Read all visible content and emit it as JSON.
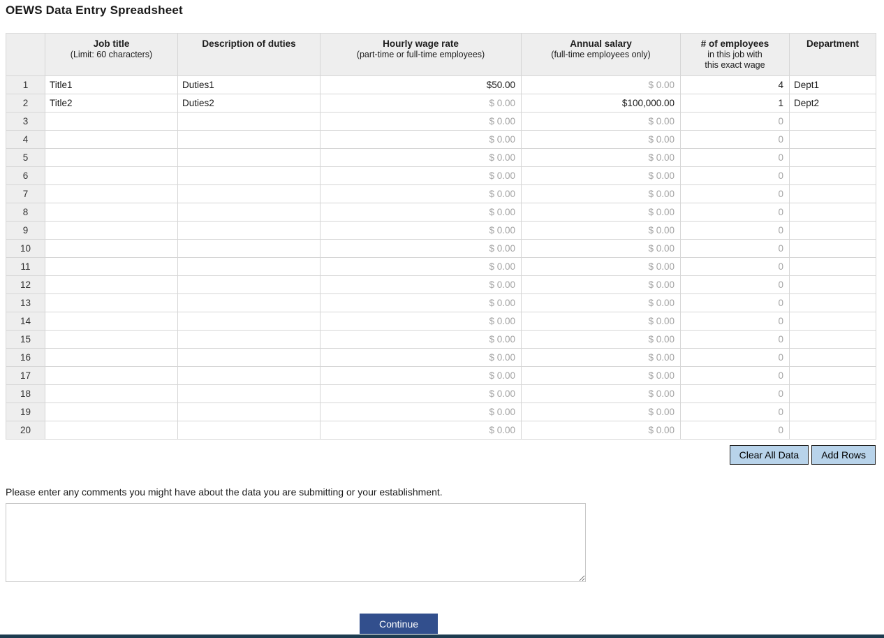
{
  "page": {
    "title": "OEWS Data Entry Spreadsheet",
    "comments_prompt": "Please enter any comments you might have about the data you are submitting or your establishment.",
    "comments_value": "",
    "continue_label": "Continue"
  },
  "toolbar": {
    "clear_all_label": "Clear All Data",
    "add_rows_label": "Add Rows"
  },
  "colors": {
    "header_bg": "#eeeeee",
    "action_button_bg": "#b8d3ea",
    "continue_button_bg": "#324f8d",
    "footer_bar": "#1d3c50",
    "muted_value_text": "#a3a3a3"
  },
  "table": {
    "headers": {
      "rownum": {
        "title": "",
        "sub": ""
      },
      "job_title": {
        "title": "Job title",
        "sub": "(Limit: 60 characters)"
      },
      "duties": {
        "title": "Description of duties",
        "sub": ""
      },
      "hourly": {
        "title": "Hourly wage rate",
        "sub": "(part-time or full-time employees)"
      },
      "annual": {
        "title": "Annual salary",
        "sub": "(full-time employees only)"
      },
      "employees": {
        "title": "# of employees",
        "sub": "in this job with\nthis exact wage"
      },
      "department": {
        "title": "Department",
        "sub": ""
      }
    },
    "rows": [
      {
        "num": "1",
        "job_title": "Title1",
        "duties": "Duties1",
        "hourly": "$50.00",
        "hourly_filled": true,
        "annual": "$ 0.00",
        "annual_filled": false,
        "employees": "4",
        "employees_filled": true,
        "department": "Dept1"
      },
      {
        "num": "2",
        "job_title": "Title2",
        "duties": "Duties2",
        "hourly": "$ 0.00",
        "hourly_filled": false,
        "annual": "$100,000.00",
        "annual_filled": true,
        "employees": "1",
        "employees_filled": true,
        "department": "Dept2"
      },
      {
        "num": "3",
        "job_title": "",
        "duties": "",
        "hourly": "$ 0.00",
        "hourly_filled": false,
        "annual": "$ 0.00",
        "annual_filled": false,
        "employees": "0",
        "employees_filled": false,
        "department": ""
      },
      {
        "num": "4",
        "job_title": "",
        "duties": "",
        "hourly": "$ 0.00",
        "hourly_filled": false,
        "annual": "$ 0.00",
        "annual_filled": false,
        "employees": "0",
        "employees_filled": false,
        "department": ""
      },
      {
        "num": "5",
        "job_title": "",
        "duties": "",
        "hourly": "$ 0.00",
        "hourly_filled": false,
        "annual": "$ 0.00",
        "annual_filled": false,
        "employees": "0",
        "employees_filled": false,
        "department": ""
      },
      {
        "num": "6",
        "job_title": "",
        "duties": "",
        "hourly": "$ 0.00",
        "hourly_filled": false,
        "annual": "$ 0.00",
        "annual_filled": false,
        "employees": "0",
        "employees_filled": false,
        "department": ""
      },
      {
        "num": "7",
        "job_title": "",
        "duties": "",
        "hourly": "$ 0.00",
        "hourly_filled": false,
        "annual": "$ 0.00",
        "annual_filled": false,
        "employees": "0",
        "employees_filled": false,
        "department": ""
      },
      {
        "num": "8",
        "job_title": "",
        "duties": "",
        "hourly": "$ 0.00",
        "hourly_filled": false,
        "annual": "$ 0.00",
        "annual_filled": false,
        "employees": "0",
        "employees_filled": false,
        "department": ""
      },
      {
        "num": "9",
        "job_title": "",
        "duties": "",
        "hourly": "$ 0.00",
        "hourly_filled": false,
        "annual": "$ 0.00",
        "annual_filled": false,
        "employees": "0",
        "employees_filled": false,
        "department": ""
      },
      {
        "num": "10",
        "job_title": "",
        "duties": "",
        "hourly": "$ 0.00",
        "hourly_filled": false,
        "annual": "$ 0.00",
        "annual_filled": false,
        "employees": "0",
        "employees_filled": false,
        "department": ""
      },
      {
        "num": "11",
        "job_title": "",
        "duties": "",
        "hourly": "$ 0.00",
        "hourly_filled": false,
        "annual": "$ 0.00",
        "annual_filled": false,
        "employees": "0",
        "employees_filled": false,
        "department": ""
      },
      {
        "num": "12",
        "job_title": "",
        "duties": "",
        "hourly": "$ 0.00",
        "hourly_filled": false,
        "annual": "$ 0.00",
        "annual_filled": false,
        "employees": "0",
        "employees_filled": false,
        "department": ""
      },
      {
        "num": "13",
        "job_title": "",
        "duties": "",
        "hourly": "$ 0.00",
        "hourly_filled": false,
        "annual": "$ 0.00",
        "annual_filled": false,
        "employees": "0",
        "employees_filled": false,
        "department": ""
      },
      {
        "num": "14",
        "job_title": "",
        "duties": "",
        "hourly": "$ 0.00",
        "hourly_filled": false,
        "annual": "$ 0.00",
        "annual_filled": false,
        "employees": "0",
        "employees_filled": false,
        "department": ""
      },
      {
        "num": "15",
        "job_title": "",
        "duties": "",
        "hourly": "$ 0.00",
        "hourly_filled": false,
        "annual": "$ 0.00",
        "annual_filled": false,
        "employees": "0",
        "employees_filled": false,
        "department": ""
      },
      {
        "num": "16",
        "job_title": "",
        "duties": "",
        "hourly": "$ 0.00",
        "hourly_filled": false,
        "annual": "$ 0.00",
        "annual_filled": false,
        "employees": "0",
        "employees_filled": false,
        "department": ""
      },
      {
        "num": "17",
        "job_title": "",
        "duties": "",
        "hourly": "$ 0.00",
        "hourly_filled": false,
        "annual": "$ 0.00",
        "annual_filled": false,
        "employees": "0",
        "employees_filled": false,
        "department": ""
      },
      {
        "num": "18",
        "job_title": "",
        "duties": "",
        "hourly": "$ 0.00",
        "hourly_filled": false,
        "annual": "$ 0.00",
        "annual_filled": false,
        "employees": "0",
        "employees_filled": false,
        "department": ""
      },
      {
        "num": "19",
        "job_title": "",
        "duties": "",
        "hourly": "$ 0.00",
        "hourly_filled": false,
        "annual": "$ 0.00",
        "annual_filled": false,
        "employees": "0",
        "employees_filled": false,
        "department": ""
      },
      {
        "num": "20",
        "job_title": "",
        "duties": "",
        "hourly": "$ 0.00",
        "hourly_filled": false,
        "annual": "$ 0.00",
        "annual_filled": false,
        "employees": "0",
        "employees_filled": false,
        "department": ""
      }
    ]
  }
}
